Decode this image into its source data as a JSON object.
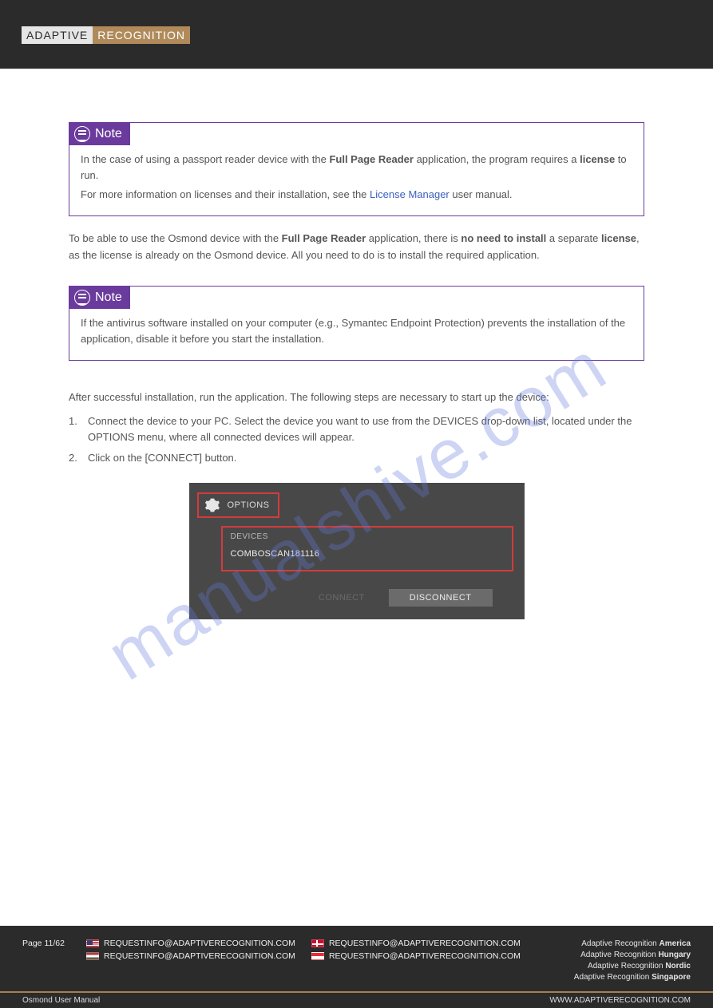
{
  "header": {
    "logo_left": "ADAPTIVE",
    "logo_right": "RECOGNITION"
  },
  "note1": {
    "label": "Note",
    "line1_prefix": "In the case of using a passport reader device with the ",
    "line1_bold": "Full Page Reader",
    "line1_suffix": " application, the program",
    "line2_prefix": "requires a ",
    "line2_bold": "license",
    "line2_suffix": " to run.",
    "sub_prefix": "For more information on licenses and their installation, see the ",
    "sub_link_text": "License Manager",
    "sub_link_href": "#",
    "sub_suffix": " user manual."
  },
  "para1_prefix": "To be able to use the Osmond device with the ",
  "para1_bold": "Full Page Reader",
  "para1_mid_a": " application, there is ",
  "para1_bold2": "no need to install",
  "para1_mid_b": " a separate ",
  "para1_bold3": "license",
  "para1_suffix": ", as the license is already on the Osmond device. All you need to do is to install the required application.",
  "note2": {
    "label": "Note",
    "line1": "If the antivirus software installed on your computer (e.g., Symantec Endpoint Protection) prevents the installation of the application, disable it before you start the installation."
  },
  "list_intro": "After successful installation, run the application. The following steps are necessary to start up the device:",
  "steps": [
    "Connect the device to your PC. Select the device you want to use from the DEVICES drop-down list, located under the OPTIONS menu, where all connected devices will appear.",
    "Click on the [CONNECT] button."
  ],
  "figure": {
    "options_label": "OPTIONS",
    "devices_label": "DEVICES",
    "device_name": "COMBOSCAN181116",
    "btn_connect": "CONNECT",
    "btn_disconnect": "DISCONNECT"
  },
  "watermark": "manualshive.com",
  "footer": {
    "page_num": "Page 11/62",
    "doc_title": "Osmond User Manual",
    "col1": [
      {
        "flag": "us",
        "text": "REQUESTINFO@ADAPTIVERECOGNITION.COM"
      },
      {
        "flag": "hu",
        "text": "REQUESTINFO@ADAPTIVERECOGNITION.COM"
      }
    ],
    "col2": [
      {
        "flag": "dk",
        "text": "REQUESTINFO@ADAPTIVERECOGNITION.COM"
      },
      {
        "flag": "sg",
        "text": "REQUESTINFO@ADAPTIVERECOGNITION.COM"
      }
    ],
    "right1": "Adaptive Recognition ",
    "right1_bold": "America",
    "right2": "Adaptive Recognition ",
    "right2_bold": "Hungary",
    "right3": "Adaptive Recognition ",
    "right3_bold": "Nordic",
    "right4": "Adaptive Recognition ",
    "right4_bold": "Singapore",
    "bottom": "WWW.ADAPTIVERECOGNITION.COM"
  }
}
